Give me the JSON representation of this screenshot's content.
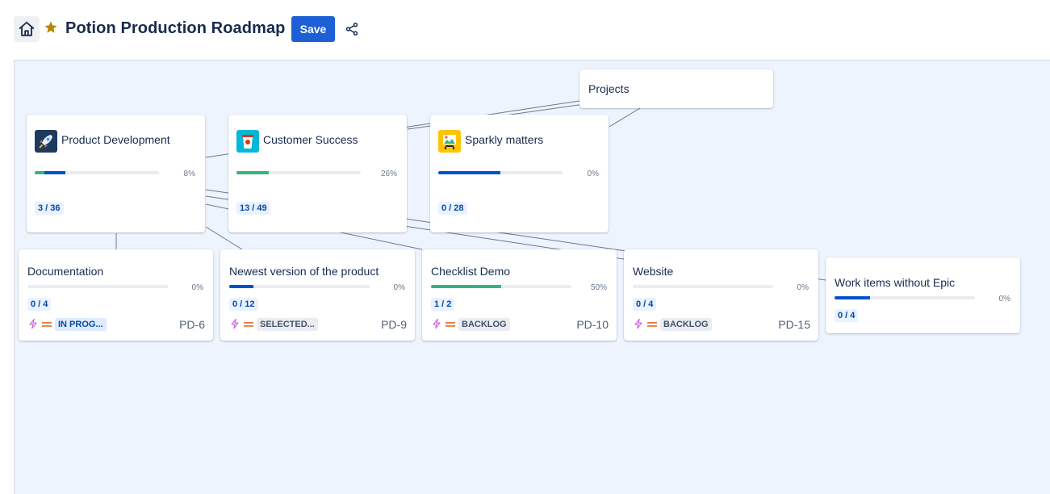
{
  "header": {
    "title": "Potion Production Roadmap",
    "save_label": "Save"
  },
  "colors": {
    "accent": "#1d5fd6",
    "canvas_bg": "#eef4fd",
    "progress_green": "#36b37e",
    "progress_blue": "#0052cc",
    "star": "#b48800"
  },
  "root": {
    "title": "Projects"
  },
  "epics": [
    {
      "title": "Product Development",
      "icon": "rocket-icon",
      "percent": "8%",
      "done_fraction": 0.08,
      "inprogress_fraction": 0.17,
      "count": "3 / 36"
    },
    {
      "title": "Customer Success",
      "icon": "coffee-cup-icon",
      "percent": "26%",
      "done_fraction": 0.26,
      "inprogress_fraction": 0.0,
      "count": "13 / 49"
    },
    {
      "title": "Sparkly matters",
      "icon": "picture-icon",
      "percent": "0%",
      "done_fraction": 0.0,
      "inprogress_fraction": 0.5,
      "count": "0 / 28"
    }
  ],
  "issues": [
    {
      "title": "Documentation",
      "percent": "0%",
      "done_fraction": 0.0,
      "inprogress_fraction": 0.0,
      "count": "0 / 4",
      "status": "IN PROG...",
      "status_style": "blue",
      "key": "PD-6"
    },
    {
      "title": "Newest version of the product",
      "percent": "0%",
      "done_fraction": 0.0,
      "inprogress_fraction": 0.17,
      "count": "0 / 12",
      "status": "SELECTED...",
      "status_style": "grey",
      "key": "PD-9"
    },
    {
      "title": "Checklist Demo",
      "percent": "50%",
      "done_fraction": 0.5,
      "inprogress_fraction": 0.0,
      "count": "1 / 2",
      "status": "BACKLOG",
      "status_style": "grey",
      "key": "PD-10"
    },
    {
      "title": "Website",
      "percent": "0%",
      "done_fraction": 0.0,
      "inprogress_fraction": 0.0,
      "count": "0 / 4",
      "status": "BACKLOG",
      "status_style": "grey",
      "key": "PD-15"
    }
  ],
  "no_epic": {
    "title": "Work items without Epic",
    "percent": "0%",
    "done_fraction": 0.0,
    "inprogress_fraction": 0.25,
    "count": "0 / 4"
  }
}
